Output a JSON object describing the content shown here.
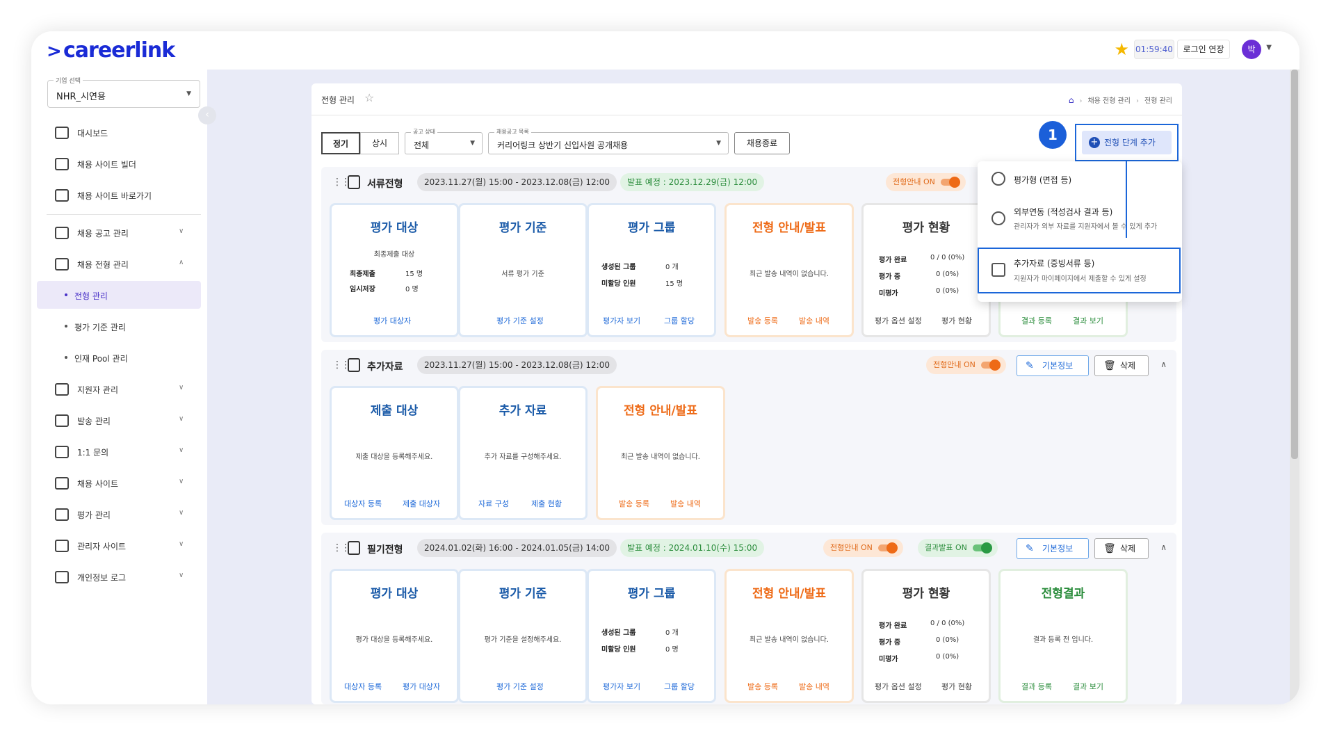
{
  "app": {
    "logo": "careerlink"
  },
  "topbar": {
    "timer": "01:59:40",
    "extend_label": "로그인 연장",
    "avatar_initial": "박"
  },
  "sidebar": {
    "corp_caption": "기업 선택",
    "corp_value": "NHR_시연용",
    "items": [
      {
        "label": "대시보드"
      },
      {
        "label": "채용 사이트 빌더"
      },
      {
        "label": "채용 사이트 바로가기"
      },
      {
        "label": "채용 공고 관리"
      },
      {
        "label": "채용 전형 관리"
      },
      {
        "label": "지원자 관리"
      },
      {
        "label": "발송 관리"
      },
      {
        "label": "1:1 문의"
      },
      {
        "label": "채용 사이트"
      },
      {
        "label": "평가 관리"
      },
      {
        "label": "관리자 사이트"
      },
      {
        "label": "개인정보 로그"
      }
    ],
    "sub_items": [
      {
        "label": "전형 관리"
      },
      {
        "label": "평가 기준 관리"
      },
      {
        "label": "인재 Pool 관리"
      }
    ]
  },
  "page": {
    "title": "전형 관리",
    "breadcrumb": [
      "채용 전형 관리",
      "전형 관리"
    ]
  },
  "filters": {
    "seg_regular": "정기",
    "seg_always": "상시",
    "status_caption": "공고 상태",
    "status_value": "전체",
    "posting_caption": "채용공고 목록",
    "posting_value": "커리어링크 상반기 신입사원 공개채용",
    "end_button": "채용종료",
    "add_stage_button": "전형 단계 추가",
    "badge": "1"
  },
  "add_menu": [
    {
      "title": "평가형 (면접 등)",
      "desc": ""
    },
    {
      "title": "외부연동 (적성검사 결과 등)",
      "desc": "관리자가 외부 자료를 지원자에서 볼 수 있게 추가"
    },
    {
      "title": "추가자료 (증빙서류 등)",
      "desc": "지원자가 마이페이지에서 제출할 수 있게 설정"
    }
  ],
  "stages": {
    "s1": {
      "name": "서류전형",
      "period": "2023.11.27(월) 15:00 - 2023.12.08(금) 12:00",
      "announce": "발표 예정 : 2023.12.29(금) 12:00",
      "guide_toggle": "전형안내 ON",
      "cards": {
        "target": {
          "title": "평가 대상",
          "sub": "최종제출 대상",
          "r1": "최종제출",
          "v1": "15 명",
          "r2": "임시저장",
          "v2": "0 명",
          "link1": "평가 대상자"
        },
        "criteria": {
          "title": "평가 기준",
          "msg": "서류 평가 기준",
          "link1": "평가 기준 설정"
        },
        "group": {
          "title": "평가 그룹",
          "r1": "생성된 그룹",
          "v1": "0 개",
          "r2": "미할당 인원",
          "v2": "15 명",
          "link1": "평가자 보기",
          "link2": "그룹 할당"
        },
        "notice": {
          "title": "전형 안내/발표",
          "msg": "최근 발송 내역이 없습니다.",
          "link1": "발송 등록",
          "link2": "발송 내역"
        },
        "status": {
          "title": "평가 현황",
          "r1": "평가 완료",
          "v1": "0 / 0 (0%)",
          "r2": "평가 중",
          "v2": "0 (0%)",
          "r3": "미평가",
          "v3": "0 (0%)",
          "link1": "평가 옵션 설정",
          "link2": "평가 현황"
        },
        "result": {
          "link1": "결과 등록",
          "link2": "결과 보기"
        }
      }
    },
    "s2": {
      "name": "추가자료",
      "period": "2023.11.27(월) 15:00 - 2023.12.08(금) 12:00",
      "guide_toggle": "전형안내 ON",
      "basic_btn": "기본정보",
      "delete_btn": "삭제",
      "cards": {
        "target": {
          "title": "제출 대상",
          "msg": "제출 대상을 등록해주세요.",
          "link1": "대상자 등록",
          "link2": "제출 대상자"
        },
        "extra": {
          "title": "추가 자료",
          "msg": "추가 자료를 구성해주세요.",
          "link1": "자료 구성",
          "link2": "제출 현황"
        },
        "notice": {
          "title": "전형 안내/발표",
          "msg": "최근 발송 내역이 없습니다.",
          "link1": "발송 등록",
          "link2": "발송 내역"
        }
      }
    },
    "s3": {
      "name": "필기전형",
      "period": "2024.01.02(화) 16:00 - 2024.01.05(금) 14:00",
      "announce": "발표 예정 : 2024.01.10(수) 15:00",
      "guide_toggle": "전형안내 ON",
      "result_toggle": "결과발표 ON",
      "basic_btn": "기본정보",
      "delete_btn": "삭제",
      "cards": {
        "target": {
          "title": "평가 대상",
          "msg": "평가 대상을 등록해주세요.",
          "link1": "대상자 등록",
          "link2": "평가 대상자"
        },
        "criteria": {
          "title": "평가 기준",
          "msg": "평가 기준을 설정해주세요.",
          "link1": "평가 기준 설정"
        },
        "group": {
          "title": "평가 그룹",
          "r1": "생성된 그룹",
          "v1": "0 개",
          "r2": "미할당 인원",
          "v2": "0 명",
          "link1": "평가자 보기",
          "link2": "그룹 할당"
        },
        "notice": {
          "title": "전형 안내/발표",
          "msg": "최근 발송 내역이 없습니다.",
          "link1": "발송 등록",
          "link2": "발송 내역"
        },
        "status": {
          "title": "평가 현황",
          "r1": "평가 완료",
          "v1": "0 / 0 (0%)",
          "r2": "평가 중",
          "v2": "0 (0%)",
          "r3": "미평가",
          "v3": "0 (0%)",
          "link1": "평가 옵션 설정",
          "link2": "평가 현황"
        },
        "result": {
          "title": "전형결과",
          "msg": "결과 등록 전 입니다.",
          "link1": "결과 등록",
          "link2": "결과 보기"
        }
      }
    }
  }
}
